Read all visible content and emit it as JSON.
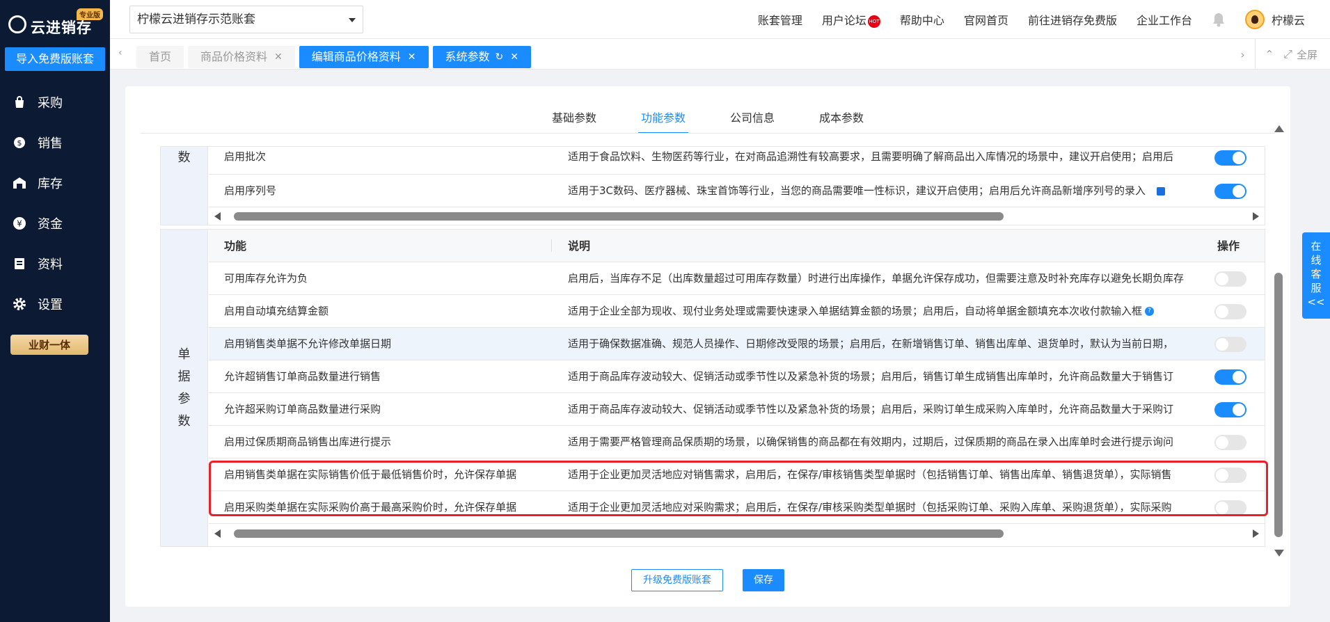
{
  "sidebar": {
    "logo_text": "云进销存",
    "logo_badge": "专业版",
    "import_button": "导入免费版账套",
    "items": [
      {
        "label": "采购",
        "icon": "bag-icon"
      },
      {
        "label": "销售",
        "icon": "sales-icon"
      },
      {
        "label": "库存",
        "icon": "warehouse-icon"
      },
      {
        "label": "资金",
        "icon": "yen-icon"
      },
      {
        "label": "资料",
        "icon": "document-icon"
      },
      {
        "label": "设置",
        "icon": "gear-icon"
      }
    ],
    "promo_badge": "业财一体"
  },
  "header": {
    "account": "柠檬云进销存示范账套",
    "links": [
      "账套管理",
      "用户论坛",
      "帮助中心",
      "官网首页",
      "前往进销存免费版",
      "企业工作台"
    ],
    "hot_badge": "HOT",
    "user_name": "柠檬云"
  },
  "tabbar": {
    "tabs": [
      {
        "label": "首页"
      },
      {
        "label": "商品价格资料"
      },
      {
        "label": "编辑商品价格资料"
      },
      {
        "label": "系统参数"
      }
    ],
    "fullscreen": "全屏"
  },
  "subtabs": [
    "基础参数",
    "功能参数",
    "公司信息",
    "成本参数"
  ],
  "top_table": {
    "group": "数",
    "rows": [
      {
        "name": "启用批次",
        "desc": "适用于食品饮料、生物医药等行业，在对商品追溯性有较高要求，且需要明确了解商品出入库情况的场景中，建议开启使用；启用后",
        "on": true
      },
      {
        "name": "启用序列号",
        "desc": "适用于3C数码、医疗器械、珠宝首饰等行业，当您的商品需要唯一性标识，建议开启使用；启用后允许商品新增序列号的录入",
        "on": true
      }
    ]
  },
  "doc_table": {
    "group": [
      "单",
      "据",
      "参",
      "数"
    ],
    "headers": {
      "name": "功能",
      "desc": "说明",
      "op": "操作"
    },
    "rows": [
      {
        "name": "可用库存允许为负",
        "desc": "启用后，当库存不足（出库数量超过可用库存数量）时进行出库操作，单据允许保存成功，但需要注意及时补充库存以避免长期负库存",
        "on": false
      },
      {
        "name": "启用自动填充结算金额",
        "desc": "适用于企业全部为现收、现付业务处理或需要快速录入单据结算金额的场景；启用后，自动将单据金额填充本次收付款输入框",
        "on": false
      },
      {
        "name": "启用销售类单据不允许修改单据日期",
        "desc": "适用于确保数据准确、规范人员操作、日期修改受限的场景；启用后，在新增销售订单、销售出库单、退货单时，默认为当前日期，",
        "on": false
      },
      {
        "name": "允许超销售订单商品数量进行销售",
        "desc": "适用于商品库存波动较大、促销活动或季节性以及紧急补货的场景；启用后，销售订单生成销售出库单时，允许商品数量大于销售订",
        "on": true
      },
      {
        "name": "允许超采购订单商品数量进行采购",
        "desc": "适用于商品库存波动较大、促销活动或季节性以及紧急补货的场景；启用后，采购订单生成采购入库单时，允许商品数量大于采购订",
        "on": true
      },
      {
        "name": "启用过保质期商品销售出库进行提示",
        "desc": "适用于需要严格管理商品保质期的场景，以确保销售的商品都在有效期内，过期后，过保质期的商品在录入出库单时会进行提示询问",
        "on": false
      },
      {
        "name": "启用销售类单据在实际销售价低于最低销售价时，允许保存单据",
        "desc": "适用于企业更加灵活地应对销售需求，启用后，在保存/审核销售类型单据时（包括销售订单、销售出库单、销售退货单），实际销售",
        "on": false
      },
      {
        "name": "启用采购类单据在实际采购价高于最高采购价时，允许保存单据",
        "desc": "适用于企业更加灵活地应对采购需求；启用后，在保存/审核采购类型单据时（包括采购订单、采购入库单、采购退货单），实际采购",
        "on": false
      }
    ]
  },
  "buttons": {
    "upgrade": "升级免费版账套",
    "save": "保存"
  },
  "service": [
    "在",
    "线",
    "客",
    "服",
    "<<"
  ],
  "colors": {
    "primary": "#1a8cff",
    "sidebar": "#0d1a33",
    "highlight": "#e8202a"
  }
}
